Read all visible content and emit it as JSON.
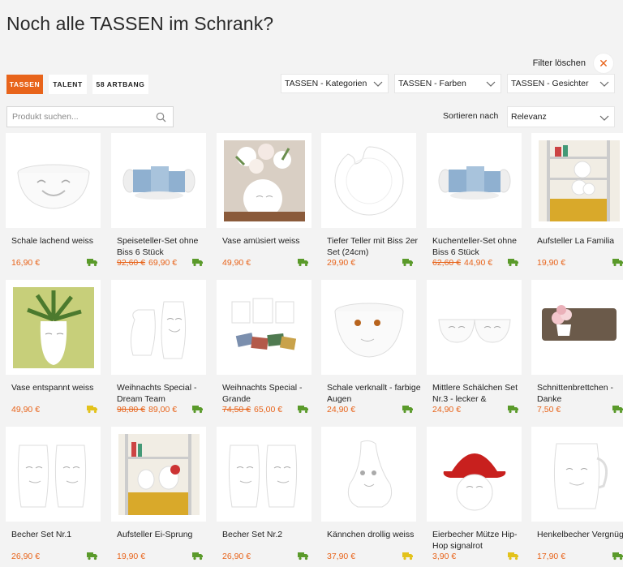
{
  "page": {
    "title": "Noch alle TASSEN im Schrank?"
  },
  "filters": {
    "clear_label": "Filter löschen",
    "chips": [
      {
        "label": "TASSEN",
        "active": true
      },
      {
        "label": "TALENT",
        "active": false
      },
      {
        "label": "58 ARTBANG",
        "active": false
      }
    ],
    "dropdowns": [
      {
        "label": "TASSEN - Kategorien"
      },
      {
        "label": "TASSEN - Farben"
      },
      {
        "label": "TASSEN - Gesichter"
      }
    ]
  },
  "search": {
    "placeholder": "Produkt suchen..."
  },
  "sort": {
    "label": "Sortieren nach",
    "value": "Relevanz"
  },
  "colors": {
    "accent": "#e8641b",
    "truck_green": "#5a9a2a",
    "truck_yellow": "#e3c21b"
  },
  "products": [
    {
      "name": "Schale lachend weiss",
      "old_price": "",
      "price": "16,90 €",
      "truck": "green",
      "image": "bowl-laughing"
    },
    {
      "name": "Speiseteller-Set ohne Biss 6 Stück",
      "old_price": "92,60 €",
      "price": "69,90 €",
      "truck": "green",
      "image": "plate-set-boxes"
    },
    {
      "name": "Vase amüsiert weiss",
      "old_price": "",
      "price": "49,90 €",
      "truck": "green",
      "image": "vase-flowers"
    },
    {
      "name": "Tiefer Teller mit Biss 2er Set (24cm)",
      "old_price": "",
      "price": "29,90 €",
      "truck": "green",
      "image": "plate-bite"
    },
    {
      "name": "Kuchenteller-Set ohne Biss 6 Stück",
      "old_price": "62,60 €",
      "price": "44,90 €",
      "truck": "green",
      "image": "plate-set-boxes"
    },
    {
      "name": "Aufsteller La Familia",
      "old_price": "",
      "price": "19,90 €",
      "truck": "green",
      "image": "shelf-display"
    },
    {
      "name": "Vase entspannt weiss",
      "old_price": "",
      "price": "49,90 €",
      "truck": "yellow",
      "image": "vase-plant"
    },
    {
      "name": "Weihnachts Special - Dream Team",
      "old_price": "98,80 €",
      "price": "89,00 €",
      "truck": "green",
      "image": "jug-cup"
    },
    {
      "name": "Weihnachts Special - Grande",
      "old_price": "74,50 €",
      "price": "65,00 €",
      "truck": "green",
      "image": "cups-cards"
    },
    {
      "name": "Schale verknallt - farbige Augen",
      "old_price": "",
      "price": "24,90 €",
      "truck": "green",
      "image": "bowl-eyes"
    },
    {
      "name": "Mittlere Schälchen Set Nr.3 - lecker &",
      "old_price": "",
      "price": "24,90 €",
      "truck": "green",
      "image": "two-bowls"
    },
    {
      "name": "Schnittenbrettchen - Danke",
      "old_price": "",
      "price": "7,50 €",
      "truck": "green",
      "image": "board-flowers"
    },
    {
      "name": "Becher Set Nr.1",
      "old_price": "",
      "price": "26,90 €",
      "truck": "green",
      "image": "two-mugs"
    },
    {
      "name": "Aufsteller Ei-Sprung",
      "old_price": "",
      "price": "19,90 €",
      "truck": "green",
      "image": "shelf-egg"
    },
    {
      "name": "Becher Set Nr.2",
      "old_price": "",
      "price": "26,90 €",
      "truck": "green",
      "image": "two-mugs"
    },
    {
      "name": "Kännchen drollig weiss",
      "old_price": "",
      "price": "37,90 €",
      "truck": "yellow",
      "image": "jug"
    },
    {
      "name": "Eierbecher Mütze Hip-Hop signalrot",
      "old_price": "",
      "price": "3,90 €",
      "truck": "yellow",
      "image": "egg-hat"
    },
    {
      "name": "Henkelbecher Vergnügt",
      "old_price": "",
      "price": "17,90 €",
      "truck": "green",
      "image": "mug"
    }
  ]
}
